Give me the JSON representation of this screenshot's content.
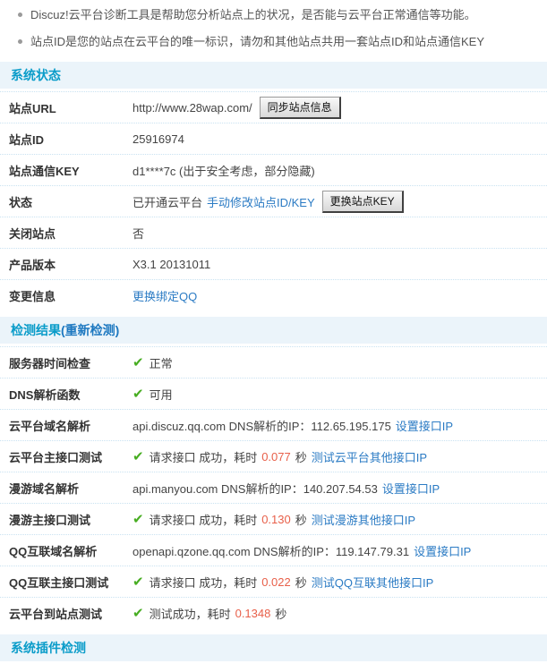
{
  "colors": {
    "accent_teal": "#0a9cc9",
    "link_blue": "#2b7bc4",
    "success_green": "#47ad21",
    "highlight_number": "#e8604a",
    "header_bg": "#ebf4fa",
    "separator": "#c9e2f1"
  },
  "icons": {
    "check": "✔"
  },
  "notes": [
    "Discuz!云平台诊断工具是帮助您分析站点上的状况，是否能与云平台正常通信等功能。",
    "站点ID是您的站点在云平台的唯一标识，请勿和其他站点共用一套站点ID和站点通信KEY"
  ],
  "section1": {
    "title": "系统状态",
    "rows": [
      {
        "label": "站点URL",
        "value": "http://www.28wap.com/",
        "button": "同步站点信息"
      },
      {
        "label": "站点ID",
        "value": "25916974"
      },
      {
        "label": "站点通信KEY",
        "value": "d1****7c (出于安全考虑，部分隐藏)"
      },
      {
        "label": "状态",
        "value": "已开通云平台",
        "link": "手动修改站点ID/KEY",
        "button": "更换站点KEY"
      },
      {
        "label": "关闭站点",
        "value": "否"
      },
      {
        "label": "产品版本",
        "value": "X3.1 20131011"
      },
      {
        "label": "变更信息",
        "link": "更换绑定QQ"
      }
    ]
  },
  "section2": {
    "title": "检测结果",
    "recheck": "(重新检测)",
    "rows": [
      {
        "label": "服务器时间检查",
        "status": "正常"
      },
      {
        "label": "DNS解析函数",
        "status": "可用"
      },
      {
        "label": "云平台域名解析",
        "text": "api.discuz.qq.com DNS解析的IP：112.65.195.175",
        "link": "设置接口IP"
      },
      {
        "label": "云平台主接口测试",
        "pre": "请求接口 成功，耗时",
        "num": "0.077",
        "unit": "秒",
        "link": "测试云平台其他接口IP"
      },
      {
        "label": "漫游域名解析",
        "text": "api.manyou.com DNS解析的IP：140.207.54.53",
        "link": "设置接口IP"
      },
      {
        "label": "漫游主接口测试",
        "pre": "请求接口 成功，耗时",
        "num": "0.130",
        "unit": "秒",
        "link": "测试漫游其他接口IP"
      },
      {
        "label": "QQ互联域名解析",
        "text": "openapi.qzone.qq.com DNS解析的IP：119.147.79.31",
        "link": "设置接口IP"
      },
      {
        "label": "QQ互联主接口测试",
        "pre": "请求接口 成功，耗时",
        "num": "0.022",
        "unit": "秒",
        "link": "测试QQ互联其他接口IP"
      },
      {
        "label": "云平台到站点测试",
        "pre": "测试成功，耗时",
        "num": "0.1348",
        "unit": "秒"
      }
    ]
  },
  "section3": {
    "title": "系统插件检测"
  }
}
